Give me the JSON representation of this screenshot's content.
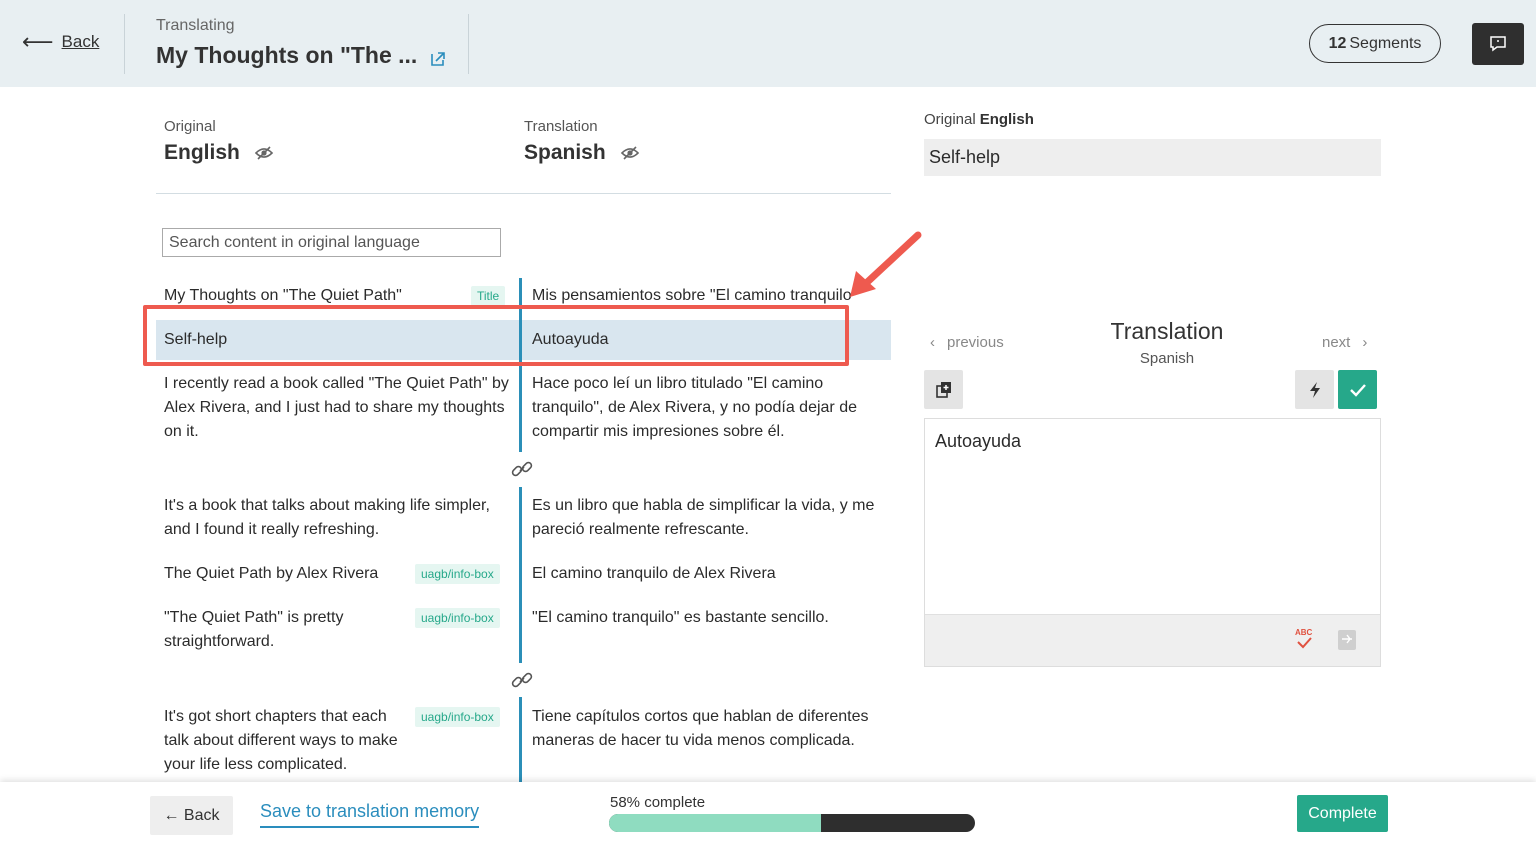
{
  "header": {
    "back_label": "Back",
    "status": "Translating",
    "title": "My Thoughts on \"The ...",
    "segments_count": "12",
    "segments_label": "Segments"
  },
  "languages": {
    "original_label": "Original",
    "original_name": "English",
    "translation_label": "Translation",
    "translation_name": "Spanish"
  },
  "search": {
    "placeholder": "Search content in original language"
  },
  "segments": [
    {
      "original": "My Thoughts on \"The Quiet Path\"",
      "tag": "Title",
      "translation": "Mis pensamientos sobre \"El camino tranquilo\""
    },
    {
      "original": "Self-help",
      "tag": "",
      "translation": "Autoayuda"
    },
    {
      "original": "I recently read a book called \"The Quiet Path\" by Alex Rivera, and I just had to share my thoughts on it.",
      "tag": "",
      "translation": "Hace poco leí un libro titulado \"El camino tranquilo\", de Alex Rivera, y no podía dejar de compartir mis impresiones sobre él."
    },
    {
      "original": "It's a book that talks about making life simpler, and I found it really refreshing.",
      "tag": "",
      "translation": "Es un libro que habla de simplificar la vida, y me pareció realmente refrescante."
    },
    {
      "original": "The Quiet Path by Alex Rivera",
      "tag": "uagb/info-box",
      "translation": "El camino tranquilo de Alex Rivera"
    },
    {
      "original": "\"The Quiet Path\" is pretty straightforward.",
      "tag": "uagb/info-box",
      "translation": "\"El camino tranquilo\" es bastante sencillo."
    },
    {
      "original": "It's got short chapters that each talk about different ways to make your life less complicated.",
      "tag": "uagb/info-box",
      "translation": "Tiene capítulos cortos que hablan de diferentes maneras de hacer tu vida menos complicada."
    }
  ],
  "panel": {
    "original_label": "Original",
    "original_lang": "English",
    "original_text": "Self-help",
    "previous": "previous",
    "next": "next",
    "heading": "Translation",
    "language": "Spanish",
    "translation_text": "Autoayuda"
  },
  "footer": {
    "back_label": "← Back",
    "save_label": "Save to translation memory",
    "progress_label": "58% complete",
    "progress_percent": 58,
    "complete_label": "Complete"
  },
  "colors": {
    "accent": "#26a88a",
    "link": "#2a8dbd",
    "highlight": "#ee5a4f",
    "divider": "#2b8fb8"
  }
}
